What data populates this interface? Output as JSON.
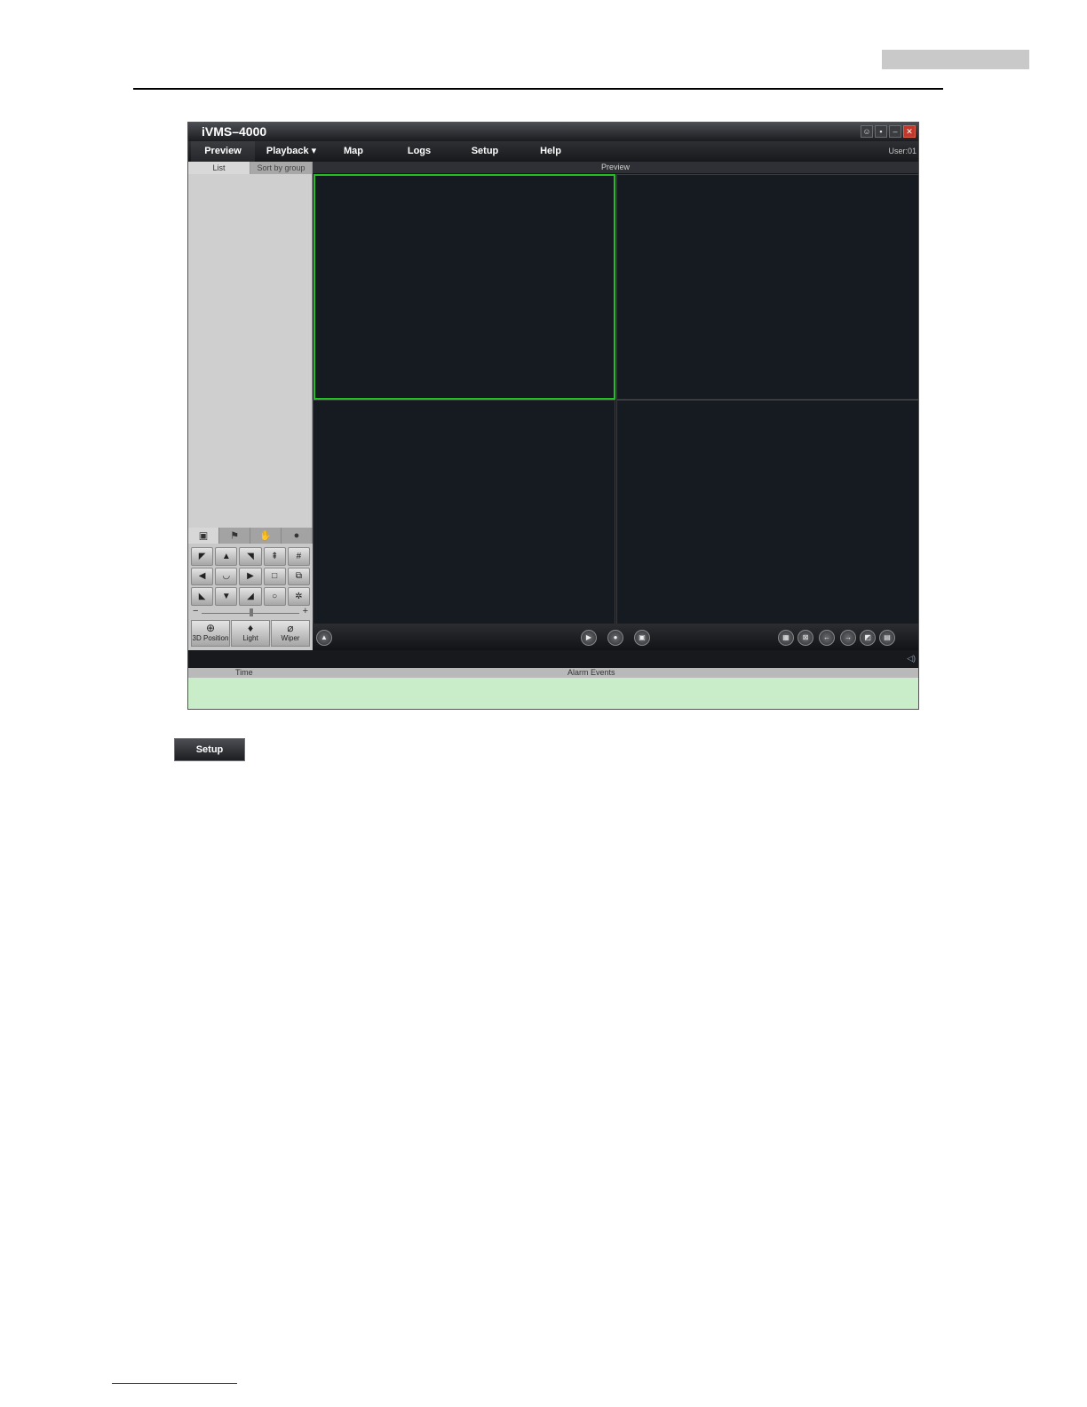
{
  "window": {
    "title": "iVMS–4000"
  },
  "menu": {
    "items": [
      "Preview",
      "Playback ▾",
      "Map",
      "Logs",
      "Setup",
      "Help"
    ],
    "user": "User:01"
  },
  "left_panel": {
    "tabs": [
      "List",
      "Sort by group"
    ],
    "ptz_buttons": [
      "3D Position",
      "Light",
      "Wiper"
    ]
  },
  "preview": {
    "header": "Preview"
  },
  "alarm_table": {
    "columns": [
      "Time",
      "Alarm Events"
    ]
  },
  "standalone_button": {
    "label": "Setup"
  },
  "colors": {
    "selected_pane_border": "#23c023",
    "alarm_body": "#c9ecc9"
  }
}
